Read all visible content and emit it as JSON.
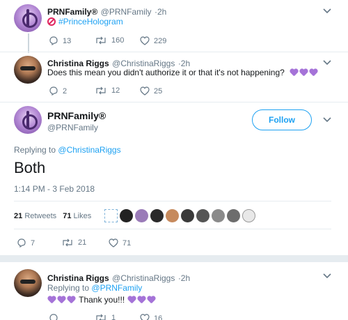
{
  "tweet1": {
    "name": "PRNFamily®",
    "handle": "@PRNFamily",
    "time": "·2h",
    "hashtag": "#PrinceHologram",
    "replies": "13",
    "retweets": "160",
    "likes": "229"
  },
  "tweet2": {
    "name": "Christina Riggs",
    "handle": "@ChristinaRiggs",
    "time": "·2h",
    "text": "Does this mean you didn't authorize it or that it's not happening?",
    "replies": "2",
    "retweets": "12",
    "likes": "25"
  },
  "main": {
    "name": "PRNFamily®",
    "handle": "@PRNFamily",
    "follow_label": "Follow",
    "replying_prefix": "Replying to",
    "replying_to": "@ChristinaRiggs",
    "text": "Both",
    "timestamp": "1:14 PM - 3 Feb 2018",
    "retweets_count": "21",
    "retweets_label": "Retweets",
    "likes_count": "71",
    "likes_label": "Likes",
    "replies": "7",
    "retweets": "21",
    "likes": "71"
  },
  "tweet3": {
    "name": "Christina Riggs",
    "handle": "@ChristinaRiggs",
    "time": "·2h",
    "replying_prefix": "Replying to",
    "replying_to": "@PRNFamily",
    "text": "Thank you!!!",
    "replies": "",
    "retweets": "1",
    "likes": "16"
  },
  "colors": {
    "accent": "#1da1f2",
    "secondary_text": "#657786",
    "emoji_purple": "#a573d8",
    "no_entry_red": "#e0245e"
  },
  "icons": [
    "reply-icon",
    "retweet-icon",
    "heart-icon",
    "chevron-down-icon",
    "no-entry-icon",
    "purple-heart-emoji"
  ]
}
